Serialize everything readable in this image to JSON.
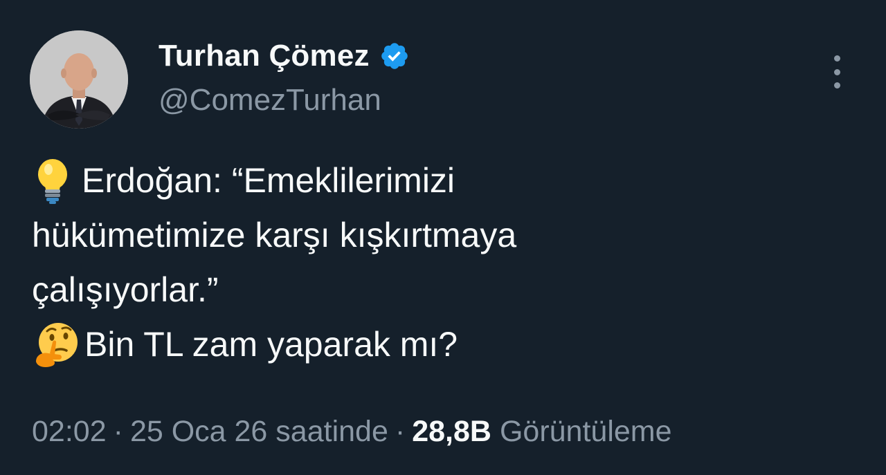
{
  "author": {
    "name": "Turhan Çömez",
    "handle": "@ComezTurhan",
    "verified": true,
    "verified_color": "#1d9bf0"
  },
  "tweet": {
    "lines": [
      {
        "emoji": "lightbulb",
        "text": "Erdoğan: “Emeklilerimizi"
      },
      {
        "emoji": null,
        "text": "hükümetimize karşı kışkırtmaya"
      },
      {
        "emoji": null,
        "text": "çalışıyorlar.”"
      },
      {
        "emoji": "thinking-face",
        "text": "Bin TL zam yaparak mı?"
      }
    ]
  },
  "meta": {
    "time": "02:02",
    "separator": "·",
    "date": "25 Oca 26 saatinde",
    "views_count": "28,8B",
    "views_label": "Görüntüleme"
  },
  "icons": {
    "more": "more-vertical-icon",
    "verified": "verified-badge-icon"
  },
  "colors": {
    "background": "#15202b",
    "text_primary": "#f7f9f9",
    "text_secondary": "#8b98a5"
  }
}
